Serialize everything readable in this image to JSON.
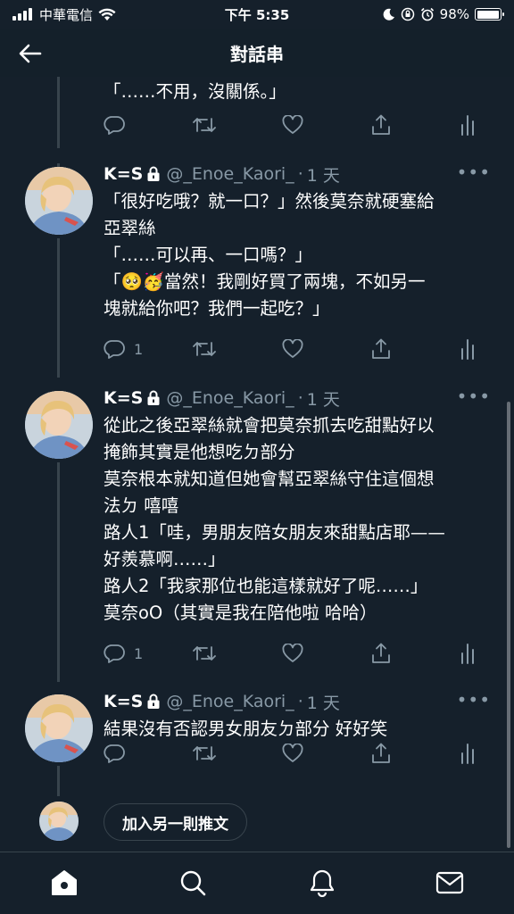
{
  "status_bar": {
    "carrier": "中華電信",
    "time": "下午 5:35",
    "battery_percent": "98%",
    "battery_level": 0.98
  },
  "header": {
    "title": "對話串"
  },
  "tweets": [
    {
      "text_lines": [
        "「……不用，沒關係。」"
      ],
      "reply_count": "",
      "retweet_count": "",
      "like_count": ""
    },
    {
      "name": "K=S",
      "handle": "@_Enoe_Kaori_",
      "dot": "·",
      "time": "1 天",
      "text_lines": [
        "「很好吃哦？就一口？」然後莫奈就硬塞給",
        "亞翠絲",
        "「……可以再、一口嗎？」",
        "「🥺🥳當然！我剛好買了兩塊，不如另一",
        "塊就給你吧？我們一起吃？」"
      ],
      "reply_count": "1",
      "retweet_count": "",
      "like_count": ""
    },
    {
      "name": "K=S",
      "handle": "@_Enoe_Kaori_",
      "dot": "·",
      "time": "1 天",
      "text_lines": [
        "從此之後亞翠絲就會把莫奈抓去吃甜點好以",
        "掩飾其實是他想吃ㄉ部分",
        "莫奈根本就知道但她會幫亞翠絲守住這個想",
        "法ㄉ 嘻嘻",
        "路人1「哇，男朋友陪女朋友來甜點店耶——",
        "好羨慕啊……」",
        "路人2「我家那位也能這樣就好了呢……」",
        "莫奈oO（其實是我在陪他啦 哈哈）"
      ],
      "reply_count": "1",
      "retweet_count": "",
      "like_count": ""
    },
    {
      "name": "K=S",
      "handle": "@_Enoe_Kaori_",
      "dot": "·",
      "time": "1 天",
      "text_lines": [
        "結果沒有否認男女朋友ㄉ部分 好好笑"
      ],
      "reply_count": "",
      "retweet_count": "",
      "like_count": ""
    }
  ],
  "composer": {
    "button_label": "加入另一則推文"
  },
  "tabs": [
    "home",
    "search",
    "notifications",
    "messages"
  ],
  "colors": {
    "background": "#15202b",
    "secondary_text": "#8899a6",
    "divider": "#38444d"
  },
  "icons": [
    "signal-icon",
    "wifi-icon",
    "moon-icon",
    "orientation-lock-icon",
    "alarm-icon",
    "battery-icon",
    "back-arrow-icon",
    "lock-icon",
    "more-icon",
    "reply-icon",
    "retweet-icon",
    "like-icon",
    "share-icon",
    "analytics-icon",
    "home-icon",
    "search-icon",
    "bell-icon",
    "mail-icon"
  ]
}
